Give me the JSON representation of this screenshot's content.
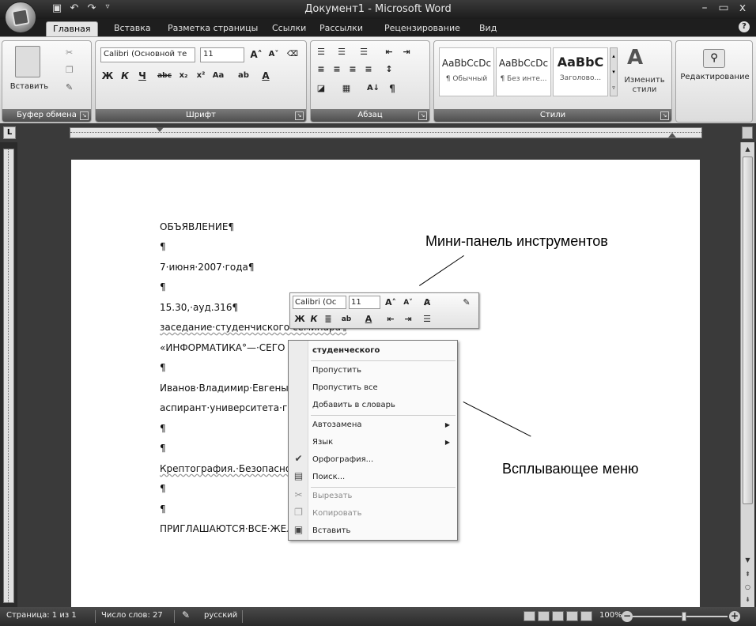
{
  "window": {
    "title": "Документ1 - Microsoft Word"
  },
  "tabs": [
    "Главная",
    "Вставка",
    "Разметка страницы",
    "Ссылки",
    "Рассылки",
    "Рецензирование",
    "Вид"
  ],
  "ribbon": {
    "clipboard": {
      "paste_label": "Вставить",
      "group_label": "Буфер обмена"
    },
    "font": {
      "font_name": "Calibri (Основной те",
      "font_size": "11",
      "group_label": "Шрифт"
    },
    "paragraph": {
      "group_label": "Абзац"
    },
    "styles": {
      "items": [
        {
          "sample": "AaBbCcDc",
          "name": "¶ Обычный"
        },
        {
          "sample": "AaBbCcDc",
          "name": "¶ Без инте..."
        },
        {
          "sample": "AaBbC",
          "name": "Заголово..."
        }
      ],
      "change_label": "Изменить стили",
      "group_label": "Стили"
    },
    "editing": {
      "label": "Редактирование"
    }
  },
  "document": {
    "lines": [
      "ОБЪЯВЛЕНИЕ¶",
      "¶",
      "7·июня·2007·года¶",
      "¶",
      "15.30,·ауд.316¶",
      "заседание·студенчиского·семинара¶",
      "«ИНФОРМАТИКА°—·СЕГО",
      "¶",
      "Иванов·Владимир·Евгены",
      "аспирант·университета·г",
      "¶",
      "¶",
      "Крептография.·Безопасно",
      "¶",
      "¶",
      "ПРИГЛАШАЮТСЯ·ВСЕ·ЖЕЛАЮЩИЕ!!!¶"
    ]
  },
  "mini_toolbar": {
    "font_name": "Calibri (Ос",
    "font_size": "11"
  },
  "context_menu": {
    "suggestion": "студенческого",
    "items": [
      {
        "label": "Пропустить",
        "disabled": false
      },
      {
        "label": "Пропустить все",
        "disabled": false
      },
      {
        "label": "Добавить в словарь",
        "disabled": false
      },
      {
        "label": "Автозамена",
        "submenu": true
      },
      {
        "label": "Язык",
        "submenu": true
      },
      {
        "label": "Орфография...",
        "icon": "spelling-icon"
      },
      {
        "label": "Поиск...",
        "icon": "research-icon"
      },
      {
        "label": "Вырезать",
        "disabled": true,
        "icon": "cut-icon"
      },
      {
        "label": "Копировать",
        "disabled": true,
        "icon": "copy-icon"
      },
      {
        "label": "Вставить",
        "icon": "paste-icon"
      }
    ]
  },
  "callouts": {
    "mini_toolbar": "Мини-панель инструментов",
    "popup_menu": "Всплывающее меню"
  },
  "statusbar": {
    "page": "Страница: 1 из 1",
    "words": "Число слов: 27",
    "language": "русский",
    "zoom": "100%"
  }
}
